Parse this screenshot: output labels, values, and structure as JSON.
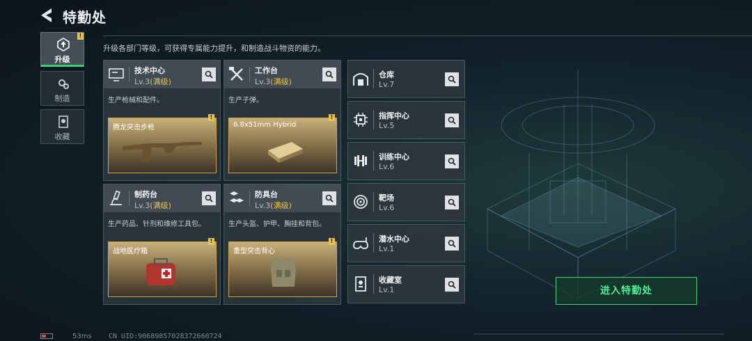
{
  "header": {
    "title": "特勤处"
  },
  "subtitle": "升级各部门等级，可获得专属能力提升，和制造战斗物资的能力。",
  "sidebar": {
    "items": [
      {
        "label": "升级",
        "icon": "upgrade-icon",
        "active": true,
        "badge": "!"
      },
      {
        "label": "制造",
        "icon": "gears-icon",
        "active": false
      },
      {
        "label": "收藏",
        "icon": "collection-icon",
        "active": false
      }
    ]
  },
  "departments": [
    {
      "name": "技术中心",
      "level": "Lv.3",
      "status": "(满级)",
      "desc": "生产枪械和配件。",
      "product": "腾龙突击步枪",
      "product_badge": "!",
      "icon": "monitor-icon"
    },
    {
      "name": "工作台",
      "level": "Lv.3",
      "status": "(满级)",
      "desc": "生产子弹。",
      "product": "6.8x51mm Hybrid",
      "product_badge": "!",
      "icon": "hammer-wrench-icon"
    },
    {
      "name": "制药台",
      "level": "Lv.3",
      "status": "(满级)",
      "desc": "生产药品、针剂和维修工具包。",
      "product": "战地医疗箱",
      "product_badge": "!",
      "icon": "microscope-icon"
    },
    {
      "name": "防具台",
      "level": "Lv.3",
      "status": "(满级)",
      "desc": "生产头盔、护甲、胸挂和背包。",
      "product": "重型突击背心",
      "product_badge": "!",
      "icon": "armor-blocks-icon"
    }
  ],
  "facilities": [
    {
      "name": "仓库",
      "level": "Lv.7",
      "icon": "warehouse-icon"
    },
    {
      "name": "指挥中心",
      "level": "Lv.5",
      "icon": "chip-icon"
    },
    {
      "name": "训练中心",
      "level": "Lv.6",
      "icon": "dumbbell-icon"
    },
    {
      "name": "靶场",
      "level": "Lv.6",
      "icon": "target-icon"
    },
    {
      "name": "潜水中心",
      "level": "Lv.1",
      "icon": "diving-mask-icon"
    },
    {
      "name": "收藏室",
      "level": "Lv.1",
      "icon": "trophy-case-icon"
    }
  ],
  "enter_button": "进入特勤处",
  "status_bar": {
    "ping": "53ms",
    "uid": "CN UID:9068985702837266072​4"
  },
  "colors": {
    "accent_green": "#3bd37c",
    "max_level": "#e8c24a",
    "badge": "#e8c24a"
  }
}
